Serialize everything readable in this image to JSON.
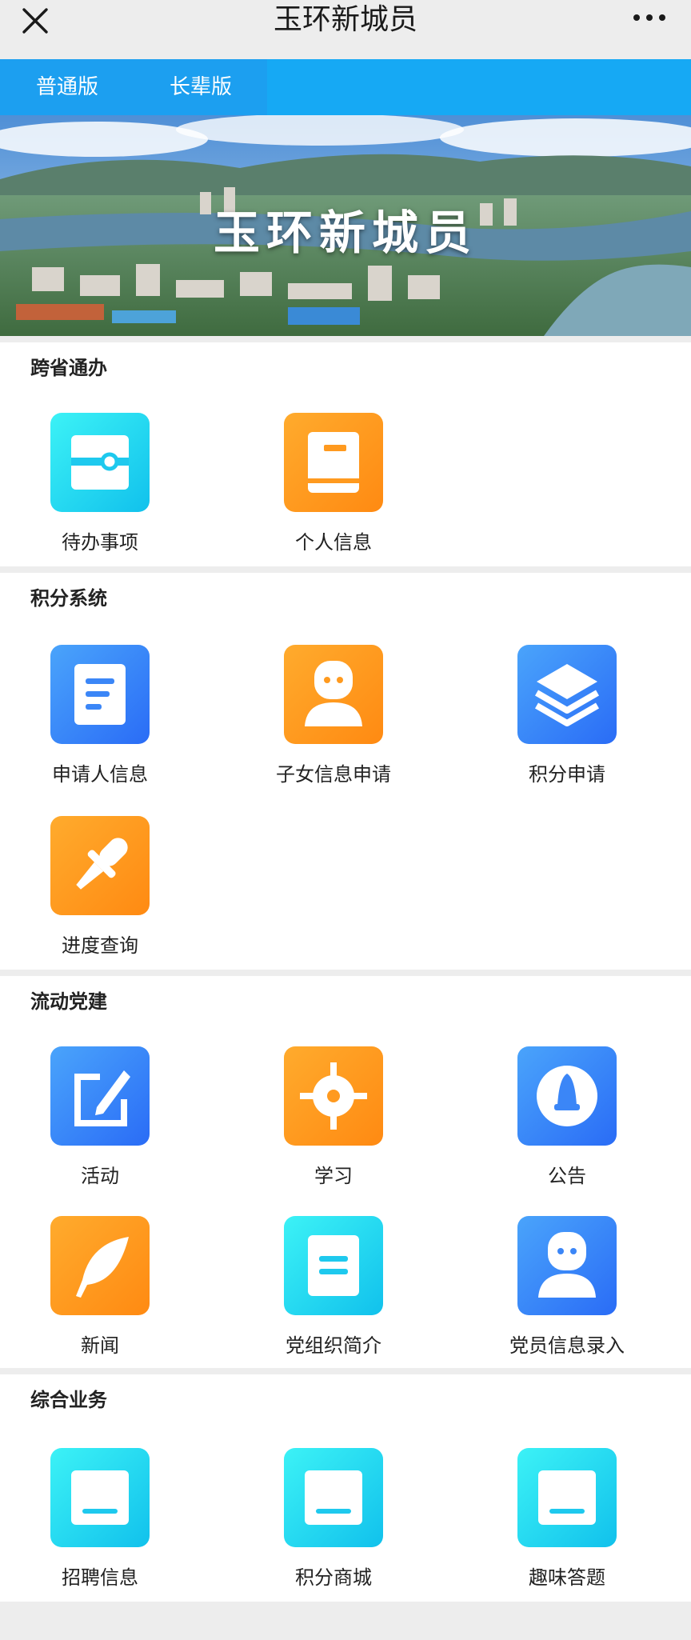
{
  "header": {
    "title": "玉环新城员",
    "close_icon": "close-icon",
    "more_icon": "more-icon"
  },
  "tabs": [
    {
      "label": "普通版"
    },
    {
      "label": "长辈版"
    }
  ],
  "banner": {
    "text": "玉环新城员"
  },
  "sections": [
    {
      "title": "跨省通办",
      "items": [
        {
          "label": "待办事项",
          "icon": "ticket-icon",
          "color": "cyan"
        },
        {
          "label": "个人信息",
          "icon": "book-icon",
          "color": "orange"
        }
      ]
    },
    {
      "title": "积分系统",
      "items": [
        {
          "label": "申请人信息",
          "icon": "document-icon",
          "color": "blue"
        },
        {
          "label": "子女信息申请",
          "icon": "person-icon",
          "color": "orange"
        },
        {
          "label": "积分申请",
          "icon": "layers-icon",
          "color": "blue"
        },
        {
          "label": "进度查询",
          "icon": "dropper-icon",
          "color": "orange"
        }
      ]
    },
    {
      "title": "流动党建",
      "items": [
        {
          "label": "活动",
          "icon": "edit-icon",
          "color": "blue"
        },
        {
          "label": "学习",
          "icon": "target-icon",
          "color": "orange"
        },
        {
          "label": "公告",
          "icon": "announcement-icon",
          "color": "blue"
        },
        {
          "label": "新闻",
          "icon": "feather-icon",
          "color": "orange"
        },
        {
          "label": "党组织简介",
          "icon": "note-icon",
          "color": "cyan"
        },
        {
          "label": "党员信息录入",
          "icon": "person-icon",
          "color": "blue"
        }
      ]
    },
    {
      "title": "综合业务",
      "items": [
        {
          "label": "招聘信息",
          "icon": "tray-icon",
          "color": "cyan"
        },
        {
          "label": "积分商城",
          "icon": "tray-icon",
          "color": "cyan"
        },
        {
          "label": "趣味答题",
          "icon": "tray-icon",
          "color": "cyan"
        }
      ]
    }
  ]
}
